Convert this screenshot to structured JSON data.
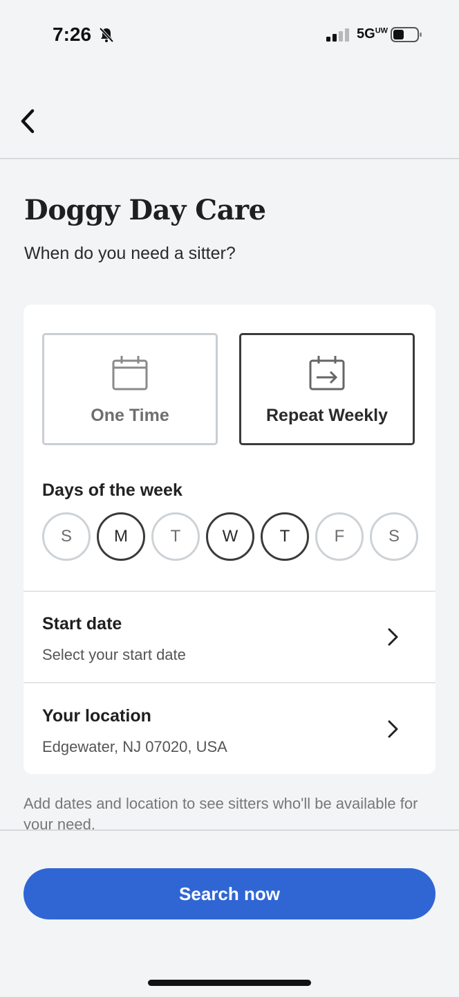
{
  "status_bar": {
    "time": "7:26",
    "network": "5G",
    "network_superscript": "UW",
    "icons": [
      "bell-muted-icon",
      "signal-bars-icon",
      "battery-icon"
    ]
  },
  "nav": {
    "back_icon": "chevron-left-icon"
  },
  "page": {
    "title": "Doggy Day Care",
    "subtitle": "When do you need a sitter?"
  },
  "frequency": {
    "options": [
      {
        "label": "One Time",
        "icon": "calendar-icon",
        "selected": false
      },
      {
        "label": "Repeat Weekly",
        "icon": "calendar-repeat-icon",
        "selected": true
      }
    ]
  },
  "days": {
    "label": "Days of the week",
    "items": [
      {
        "letter": "S",
        "name": "sunday",
        "selected": false
      },
      {
        "letter": "M",
        "name": "monday",
        "selected": true
      },
      {
        "letter": "T",
        "name": "tuesday",
        "selected": false
      },
      {
        "letter": "W",
        "name": "wednesday",
        "selected": true
      },
      {
        "letter": "T",
        "name": "thursday",
        "selected": true
      },
      {
        "letter": "F",
        "name": "friday",
        "selected": false
      },
      {
        "letter": "S",
        "name": "saturday",
        "selected": false
      }
    ]
  },
  "start_date": {
    "title": "Start date",
    "value": "Select your start date"
  },
  "location": {
    "title": "Your location",
    "value": "Edgewater, NJ 07020, USA"
  },
  "helper_text": "Add dates and location to see sitters who'll be available for your need.",
  "search_button": {
    "label": "Search now"
  },
  "colors": {
    "accent": "#2f66d4",
    "background": "#f3f4f6",
    "card": "#ffffff",
    "selected_border": "#3a3a3a",
    "unselected_border": "#c9ced3"
  }
}
